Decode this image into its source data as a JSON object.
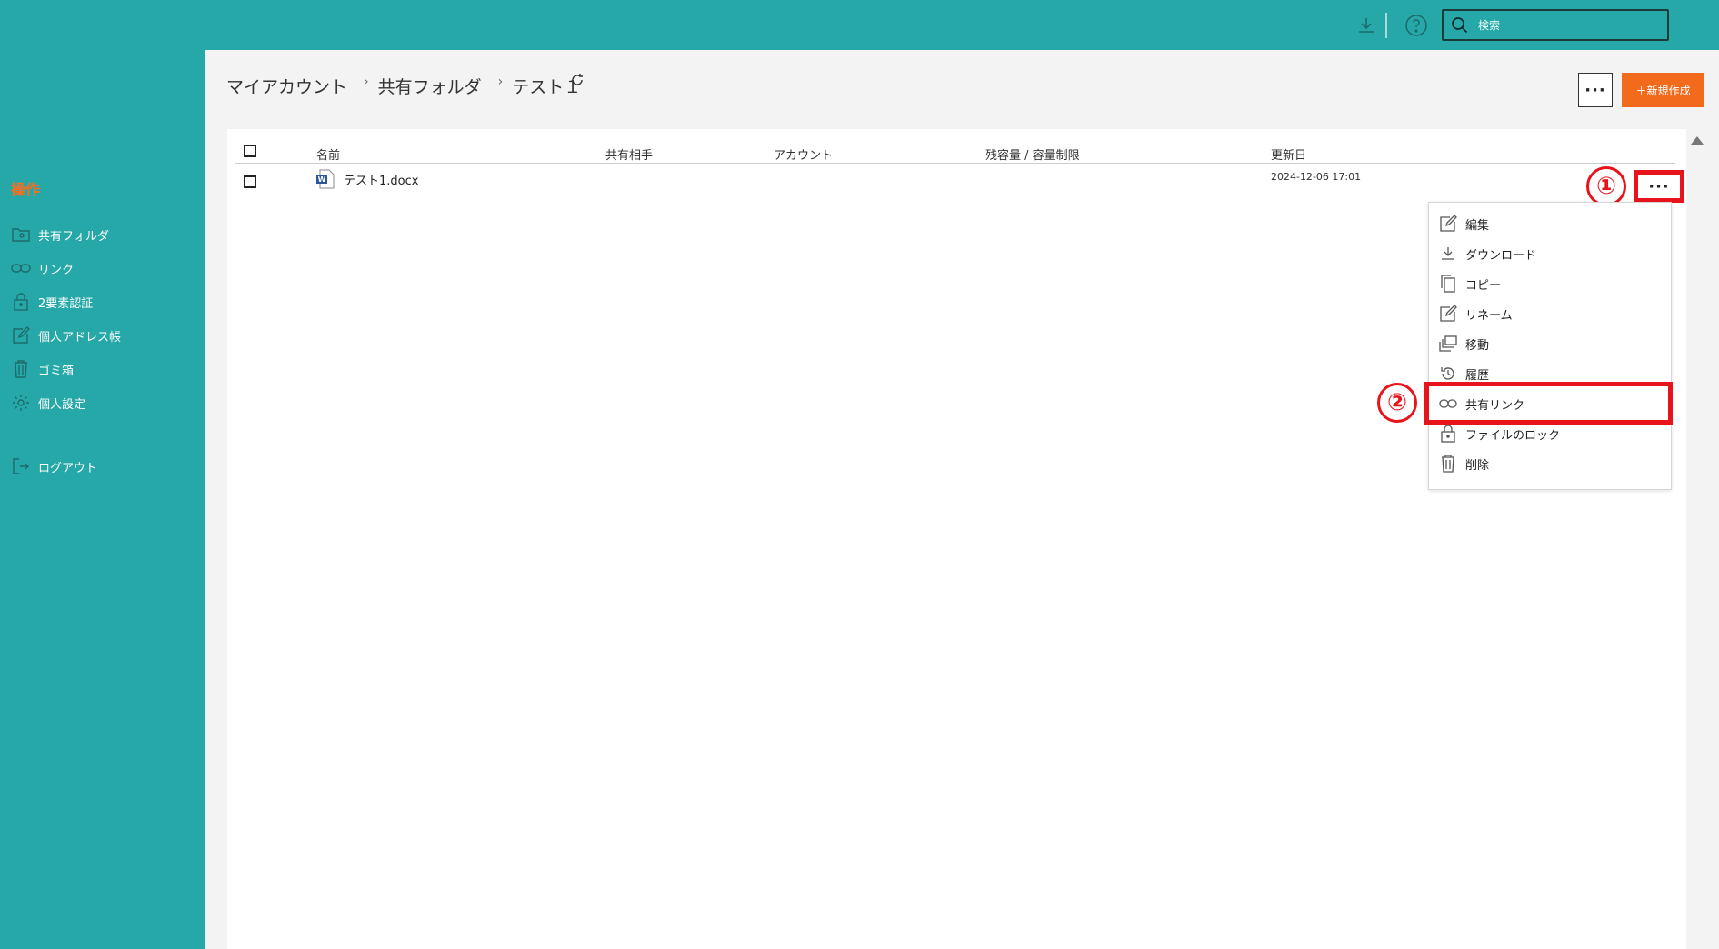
{
  "topbar": {
    "search_placeholder": "検索"
  },
  "sidebar": {
    "heading": "操作",
    "items": [
      {
        "label": "共有フォルダ",
        "icon": "folder-icon"
      },
      {
        "label": "リンク",
        "icon": "link-icon"
      },
      {
        "label": "2要素認証",
        "icon": "lock-icon"
      },
      {
        "label": "個人アドレス帳",
        "icon": "edit-icon"
      },
      {
        "label": "ゴミ箱",
        "icon": "trash-icon"
      },
      {
        "label": "個人設定",
        "icon": "gear-icon"
      }
    ],
    "logout": {
      "label": "ログアウト",
      "icon": "logout-icon"
    }
  },
  "breadcrumb": [
    "マイアカウント",
    "共有フォルダ",
    "テスト１"
  ],
  "toolbar": {
    "more_label": "···",
    "new_label": "＋新規作成"
  },
  "table": {
    "headers": [
      "名前",
      "共有相手",
      "アカウント",
      "残容量 / 容量制限",
      "更新日"
    ],
    "rows": [
      {
        "name": "テスト1.docx",
        "shared_with": "",
        "account": "",
        "capacity": "",
        "updated": "2024-12-06 17:01"
      }
    ],
    "row_more_label": "···"
  },
  "context_menu": [
    {
      "label": "編集",
      "icon": "edit-icon"
    },
    {
      "label": "ダウンロード",
      "icon": "download-icon"
    },
    {
      "label": "コピー",
      "icon": "copy-icon"
    },
    {
      "label": "リネーム",
      "icon": "rename-icon"
    },
    {
      "label": "移動",
      "icon": "move-icon"
    },
    {
      "label": "履歴",
      "icon": "history-icon"
    },
    {
      "label": "共有リンク",
      "icon": "link-icon"
    },
    {
      "label": "ファイルのロック",
      "icon": "lock-icon"
    },
    {
      "label": "削除",
      "icon": "trash-icon"
    }
  ],
  "annotations": {
    "step1": "①",
    "step2": "②",
    "color": "#e8141c"
  },
  "colors": {
    "teal": "#27a8a8",
    "orange": "#f26b1d"
  }
}
